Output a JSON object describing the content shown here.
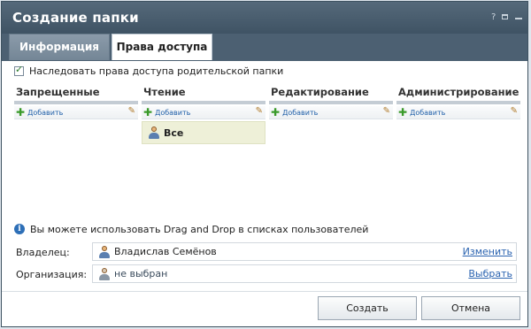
{
  "dialog": {
    "title": "Создание папки",
    "controls": {
      "help": "?"
    }
  },
  "tabs": [
    {
      "label": "Информация",
      "active": false
    },
    {
      "label": "Права доступа",
      "active": true
    }
  ],
  "inherit": {
    "checked": true,
    "label": "Наследовать права доступа родительской папки"
  },
  "columns": [
    {
      "title": "Запрещенные",
      "add_label": "Добавить",
      "items": []
    },
    {
      "title": "Чтение",
      "add_label": "Добавить",
      "items": [
        {
          "label": "Все"
        }
      ]
    },
    {
      "title": "Редактирование",
      "add_label": "Добавить",
      "items": []
    },
    {
      "title": "Администрирование",
      "add_label": "Добавить",
      "items": []
    }
  ],
  "hint": "Вы можете использовать Drag and Drop в списках пользователей",
  "owner": {
    "label": "Владелец:",
    "value": "Владислав Семёнов",
    "action": "Изменить"
  },
  "organization": {
    "label": "Организация:",
    "value": "не выбран",
    "action": "Выбрать"
  },
  "buttons": {
    "create": "Создать",
    "cancel": "Отмена"
  },
  "colors": {
    "titlebar": "#4a5e70",
    "link": "#2a63b0",
    "add_plus": "#3a9a2a",
    "selected_item_bg": "#eef0d8"
  }
}
